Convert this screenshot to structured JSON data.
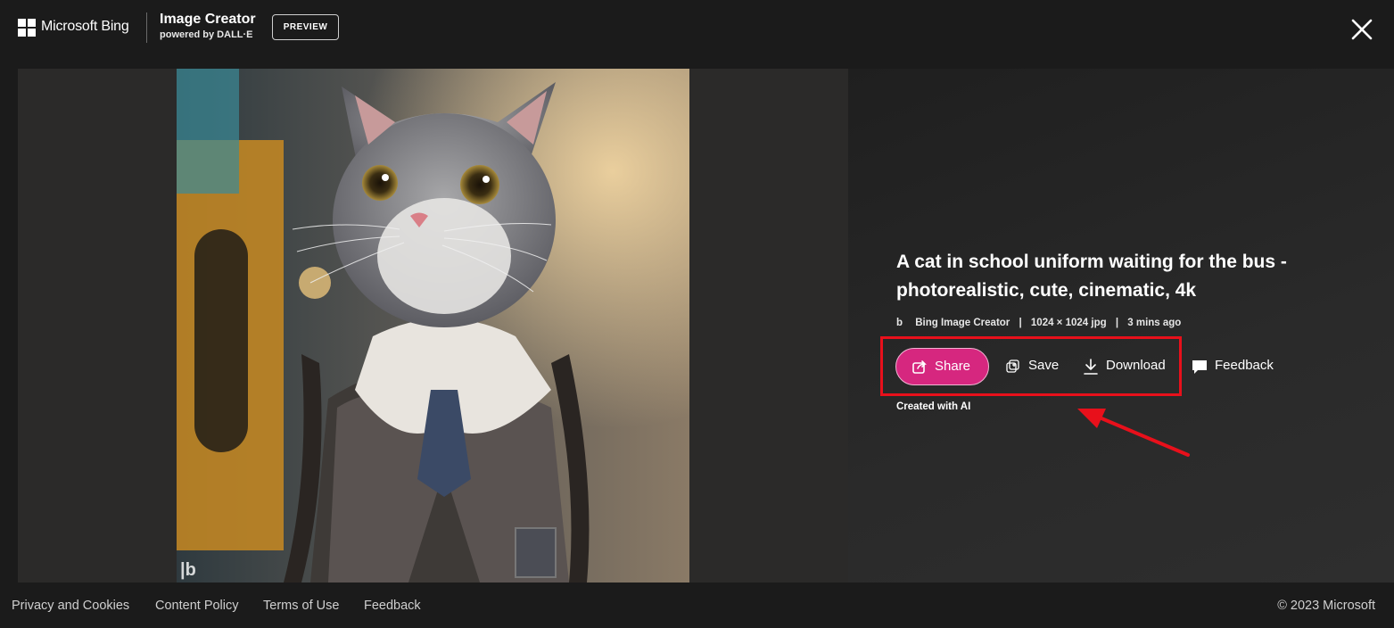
{
  "header": {
    "brand": "Microsoft Bing",
    "product_title": "Image Creator",
    "product_subtitle": "powered by DALL·E",
    "badge": "PREVIEW",
    "close_icon": "close-icon"
  },
  "image": {
    "alt": "A cat in school uniform waiting for the bus",
    "watermark_icon": "bing-logo-icon"
  },
  "details": {
    "prompt": "A cat in school uniform waiting for the bus - photorealistic, cute, cinematic, 4k",
    "source": "Bing Image Creator",
    "dimensions": "1024 × 1024 jpg",
    "age": "3 mins ago",
    "separator": "|",
    "created_with": "Created with AI"
  },
  "actions": {
    "share": "Share",
    "save": "Save",
    "download": "Download",
    "feedback": "Feedback",
    "share_color": "#d6277f",
    "highlight_color": "#e8101b"
  },
  "footer": {
    "links": [
      "Privacy and Cookies",
      "Content Policy",
      "Terms of Use",
      "Feedback"
    ],
    "copyright": "© 2023 Microsoft"
  }
}
